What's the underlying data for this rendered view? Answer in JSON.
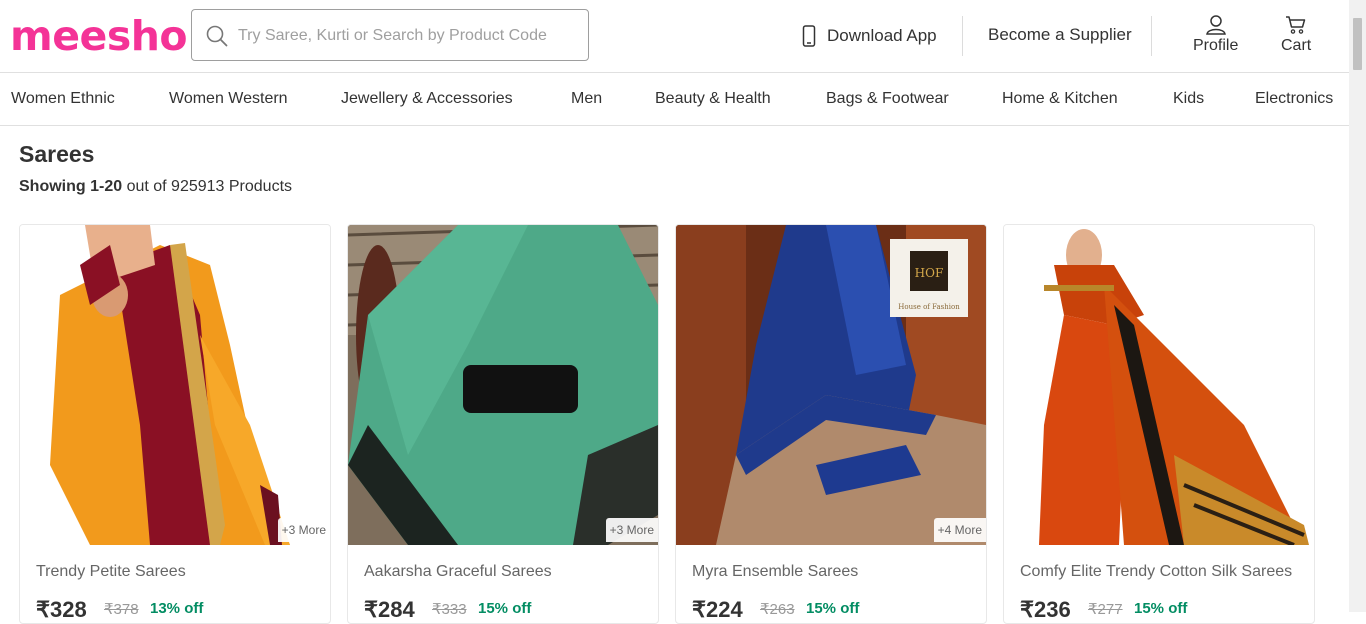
{
  "header": {
    "logo": "meesho",
    "search_placeholder": "Try Saree, Kurti or Search by Product Code",
    "download_app": "Download App",
    "become_supplier": "Become a Supplier",
    "profile": "Profile",
    "cart": "Cart"
  },
  "categories": [
    "Women Ethnic",
    "Women Western",
    "Jewellery & Accessories",
    "Men",
    "Beauty & Health",
    "Bags & Footwear",
    "Home & Kitchen",
    "Kids",
    "Electronics"
  ],
  "listing": {
    "title": "Sarees",
    "count_prefix": "Showing 1-20",
    "count_suffix": " out of 925913 Products"
  },
  "products": [
    {
      "name": "Trendy Petite Sarees",
      "price": "₹328",
      "mrp": "₹378",
      "discount": "13% off",
      "more": "+3 More"
    },
    {
      "name": "Aakarsha Graceful Sarees",
      "price": "₹284",
      "mrp": "₹333",
      "discount": "15% off",
      "more": "+3 More"
    },
    {
      "name": "Myra Ensemble Sarees",
      "price": "₹224",
      "mrp": "₹263",
      "discount": "15% off",
      "more": "+4 More"
    },
    {
      "name": "Comfy Elite Trendy Cotton Silk Sarees",
      "price": "₹236",
      "mrp": "₹277",
      "discount": "15% off",
      "more": ""
    }
  ],
  "product_image_labels": {
    "brand_badge": "HOF",
    "brand_badge_sub": "House of Fashion"
  },
  "colors": {
    "brand": "#f43397",
    "discount": "#038d63"
  },
  "icons": [
    "search-icon",
    "mobile-phone-icon",
    "profile-icon",
    "cart-icon"
  ]
}
